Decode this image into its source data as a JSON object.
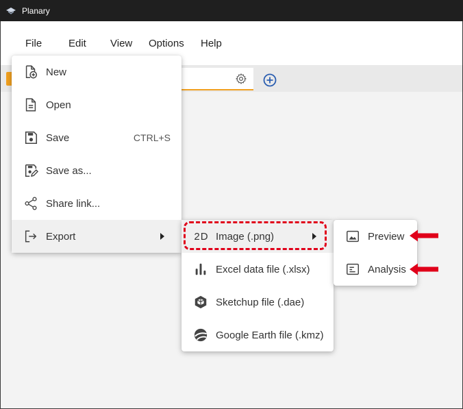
{
  "window": {
    "title": "Planary"
  },
  "menubar": {
    "items": [
      {
        "label": "File"
      },
      {
        "label": "Edit"
      },
      {
        "label": "View"
      },
      {
        "label": "Options"
      },
      {
        "label": "Help"
      }
    ]
  },
  "file_menu": {
    "new_label": "New",
    "open_label": "Open",
    "save_label": "Save",
    "save_shortcut": "CTRL+S",
    "save_as_label": "Save as...",
    "share_label": "Share link...",
    "export_label": "Export"
  },
  "export_menu": {
    "image_label": "Image (.png)",
    "image_icon_text": "2D",
    "excel_label": "Excel data file (.xlsx)",
    "sketchup_label": "Sketchup file (.dae)",
    "kmz_label": "Google Earth file (.kmz)"
  },
  "image_menu": {
    "preview_label": "Preview",
    "analysis_label": "Analysis"
  },
  "colors": {
    "accent": "#f0a020",
    "annotation_red": "#e0001a",
    "add_tab_blue": "#2a5db0"
  }
}
